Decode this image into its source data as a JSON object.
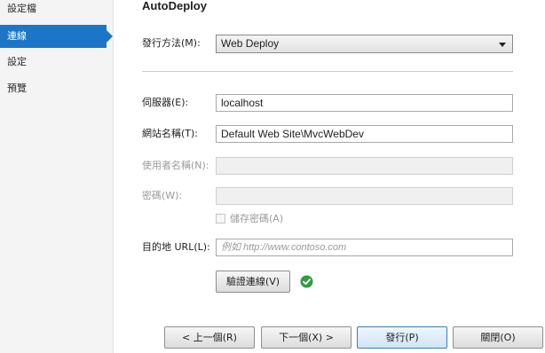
{
  "sidebar": {
    "items": [
      {
        "label": "設定檔"
      },
      {
        "label": "連線"
      },
      {
        "label": "設定"
      },
      {
        "label": "預覽"
      }
    ]
  },
  "main": {
    "title": "AutoDeploy",
    "publish_method": {
      "label": "發行方法(M):",
      "value": "Web Deploy"
    },
    "server": {
      "label": "伺服器(E):",
      "value": "localhost"
    },
    "site_name": {
      "label": "網站名稱(T):",
      "value": "Default Web Site\\MvcWebDev"
    },
    "username": {
      "label": "使用者名稱(N):",
      "value": ""
    },
    "password": {
      "label": "密碼(W):",
      "value": ""
    },
    "save_password": {
      "label": "儲存密碼(A)",
      "checked": false
    },
    "destination_url": {
      "label": "目的地 URL(L):",
      "placeholder": "例如 http://www.contoso.com"
    },
    "validate_button": "驗證連線(V)",
    "validation_status_icon": "check-circle-icon"
  },
  "footer": {
    "prev_button": "< 上一個(R)",
    "next_button": "下一個(X) >",
    "publish_button": "發行(P)",
    "close_button": "關閉(O)"
  },
  "colors": {
    "accent": "#1b76c8",
    "success": "#2e9e3f"
  }
}
